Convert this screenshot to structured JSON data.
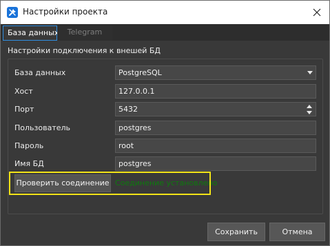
{
  "window": {
    "title": "Настройки проекта",
    "icon": "wrench-screwdriver-icon",
    "close_icon": "close-icon"
  },
  "tabs": [
    {
      "label": "База данных",
      "active": true
    },
    {
      "label": "Telegram",
      "active": false
    }
  ],
  "section": {
    "title": "Настройки подключения к внешей БД"
  },
  "form": {
    "database": {
      "label": "База данных",
      "value": "PostgreSQL"
    },
    "host": {
      "label": "Хост",
      "value": "127.0.0.1"
    },
    "port": {
      "label": "Порт",
      "value": "5432"
    },
    "user": {
      "label": "Пользователь",
      "value": "postgres"
    },
    "password": {
      "label": "Пароль",
      "value": "root"
    },
    "dbname": {
      "label": "Имя БД",
      "value": "postgres"
    }
  },
  "connection": {
    "check_label": "Проверить соединение",
    "status": "Соединение установлено",
    "status_color": "#0e7a0e",
    "highlight_color": "#f2e317"
  },
  "footer": {
    "save_label": "Сохранить",
    "cancel_label": "Отмена"
  }
}
